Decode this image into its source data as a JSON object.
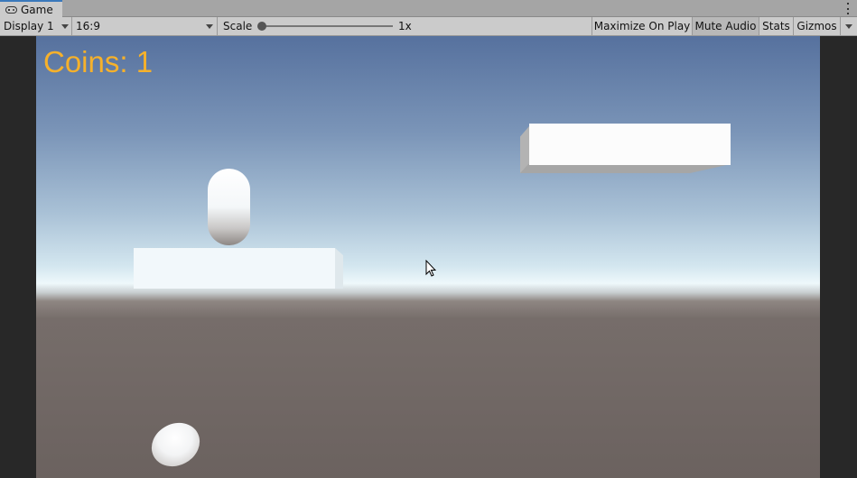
{
  "tab": {
    "title": "Game",
    "icon": "gamepad-icon"
  },
  "toolbar": {
    "display": "Display 1",
    "aspect": "16:9",
    "scale_label": "Scale",
    "scale_value": "1x",
    "maximize": "Maximize On Play",
    "mute": "Mute Audio",
    "stats": "Stats",
    "gizmos": "Gizmos"
  },
  "game": {
    "coins_text": "Coins: 1"
  },
  "colors": {
    "accent_tab": "#3a79bb",
    "coins_text": "#f6b12b",
    "toolbar_bg": "#cbcbcb"
  }
}
